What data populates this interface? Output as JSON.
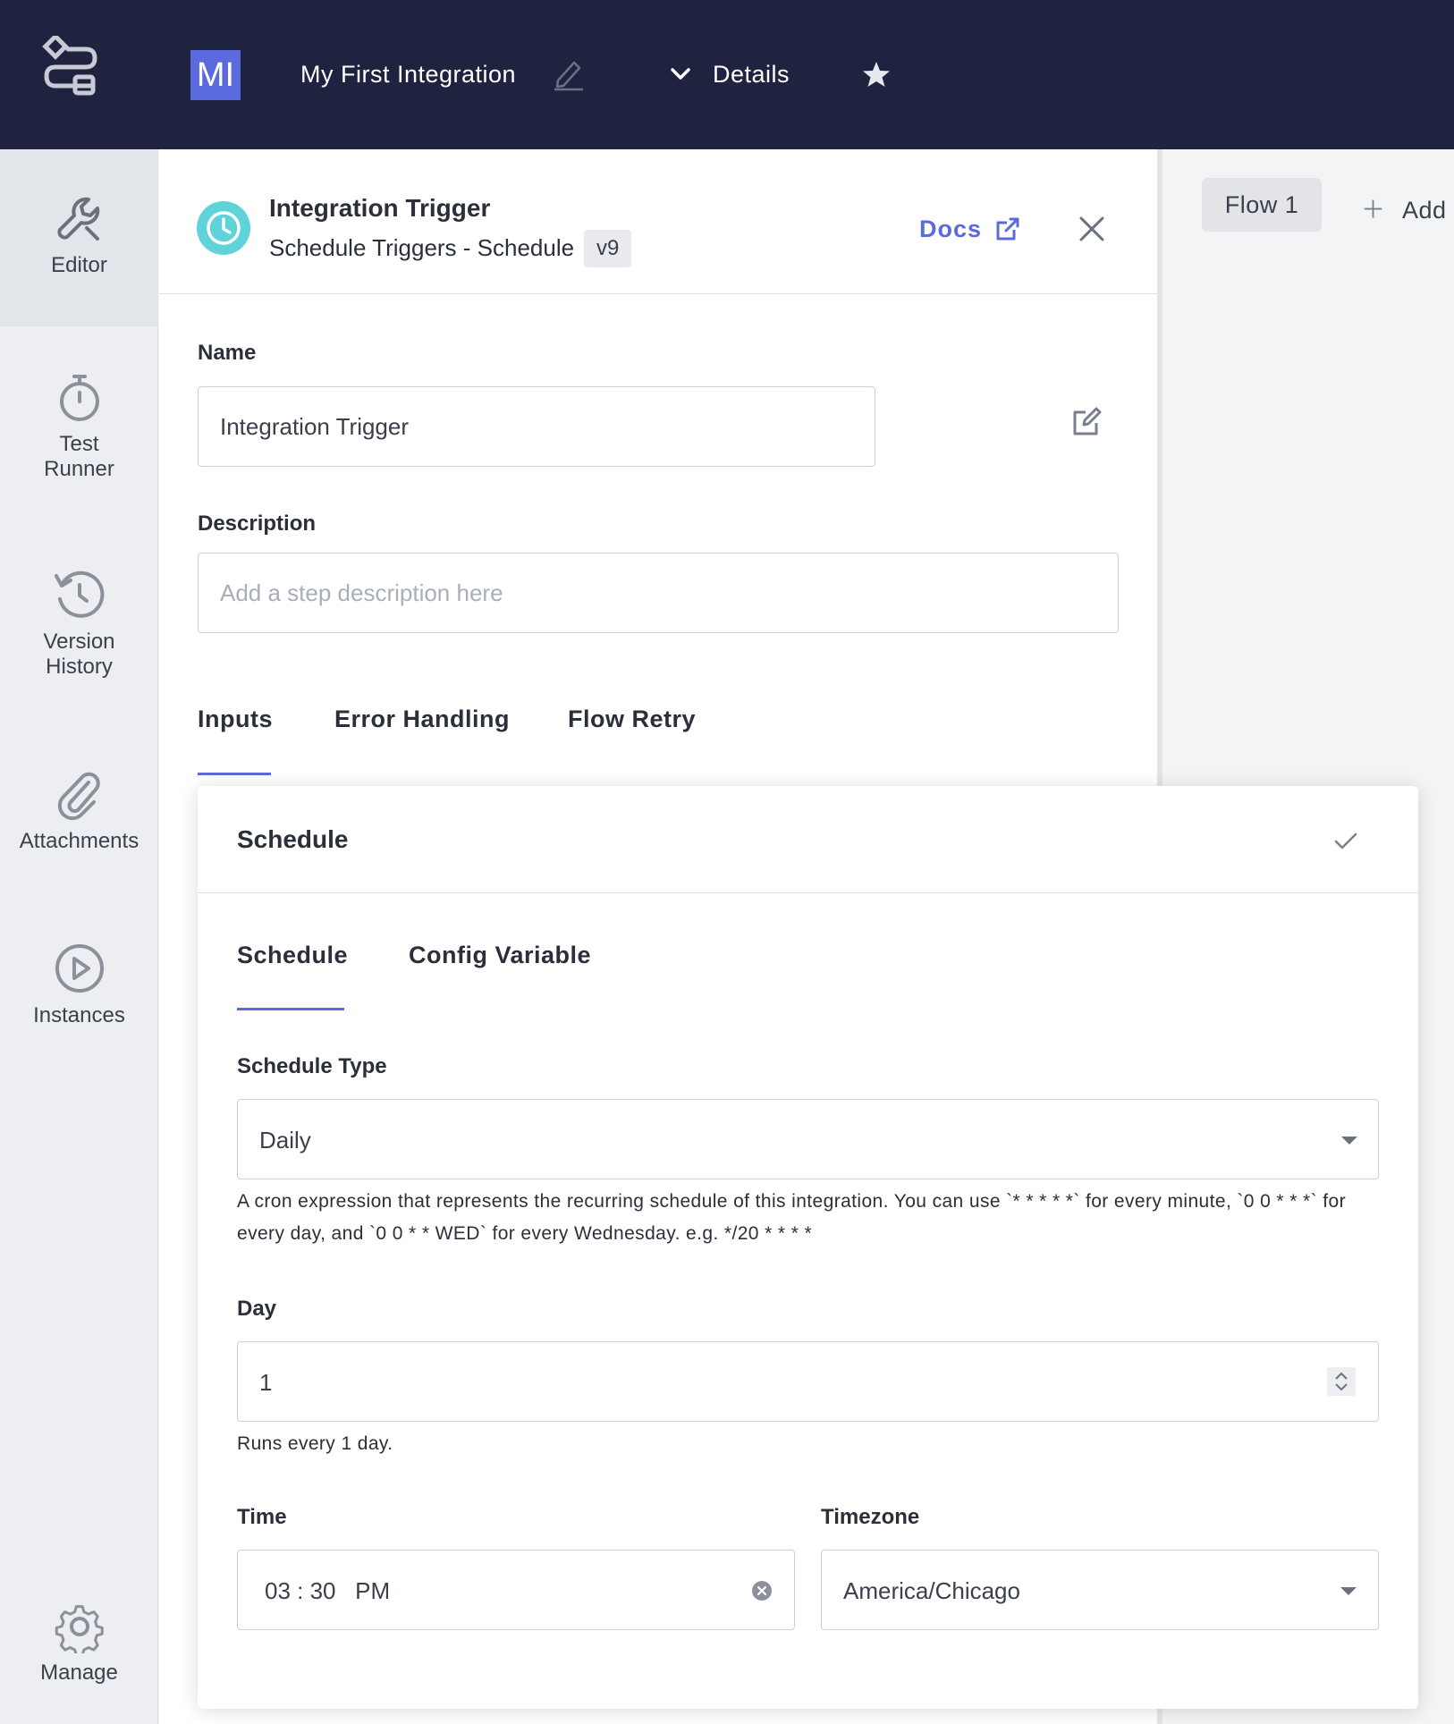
{
  "topbar": {
    "avatar_initials": "MI",
    "integration_title": "My First Integration",
    "details_label": "Details"
  },
  "rail": {
    "items": [
      {
        "label": "Editor",
        "icon": "wrench-icon"
      },
      {
        "label": "Test\nRunner",
        "icon": "stopwatch-icon"
      },
      {
        "label": "Version\nHistory",
        "icon": "history-icon"
      },
      {
        "label": "Attachments",
        "icon": "paperclip-icon"
      },
      {
        "label": "Instances",
        "icon": "play-circle-icon"
      },
      {
        "label": "Manage",
        "icon": "gear-icon"
      }
    ]
  },
  "step": {
    "title": "Integration Trigger",
    "subtitle": "Schedule Triggers - Schedule",
    "version": "v9",
    "docs_label": "Docs"
  },
  "form": {
    "name_label": "Name",
    "name_value": "Integration Trigger",
    "description_label": "Description",
    "description_placeholder": "Add a step description here"
  },
  "tabs": [
    "Inputs",
    "Error Handling",
    "Flow Retry"
  ],
  "flows": {
    "tab_label": "Flow 1",
    "add_label": "Add"
  },
  "schedule_card": {
    "title": "Schedule",
    "subtabs": [
      "Schedule",
      "Config Variable"
    ],
    "schedule_type_label": "Schedule Type",
    "schedule_type_value": "Daily",
    "cron_help": "A cron expression that represents the recurring schedule of this integration. You can use `* * * * *` for every minute, `0 0 * * *` for every day, and `0 0 * * WED` for every Wednesday. e.g. */20 * * * *",
    "day_label": "Day",
    "day_value": "1",
    "day_help": "Runs every 1 day.",
    "time_label": "Time",
    "time_value": "03 : 30   PM",
    "timezone_label": "Timezone",
    "timezone_value": "America/Chicago"
  },
  "colors": {
    "topbar_bg": "#1f2340",
    "accent": "#5b6bde",
    "trigger_icon": "#5fd3d9"
  }
}
